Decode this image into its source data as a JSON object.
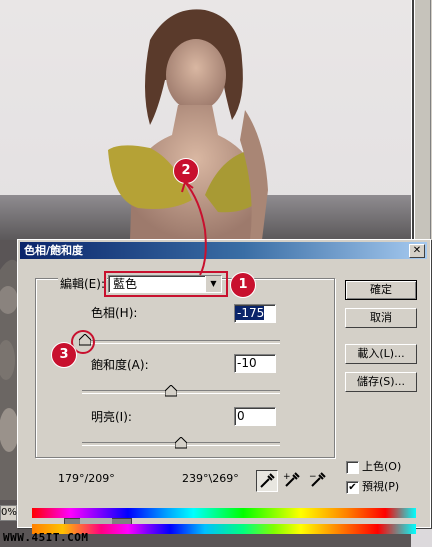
{
  "dialog": {
    "title": "色相/飽和度",
    "close_label": "✕",
    "edit_label": "編輯(E):",
    "edit_value": "藍色",
    "hue_label": "色相(H):",
    "hue_value": "-175",
    "saturation_label": "飽和度(A):",
    "saturation_value": "-10",
    "lightness_label": "明亮(I):",
    "lightness_value": "0",
    "range_left": "179°/209°",
    "range_right": "239°\\269°",
    "buttons": {
      "ok": "確定",
      "cancel": "取消",
      "load": "載入(L)...",
      "save": "儲存(S)..."
    },
    "colorize_label": "上色(O)",
    "colorize_checked": false,
    "preview_label": "預視(P)",
    "preview_checked": true,
    "preview_mark": "✔"
  },
  "sliders": {
    "hue_fraction": 0.014,
    "saturation_fraction": 0.45,
    "lightness_fraction": 0.5
  },
  "annotations": [
    "1",
    "2",
    "3"
  ],
  "zoom_text": "0%",
  "watermark": "WWW.45IT.COM",
  "colors": {
    "accent_red": "#c8102e",
    "title_blue": "#0a246a",
    "dialog_gray": "#d4d0c8"
  },
  "icons": [
    "eyedropper-icon",
    "eyedropper-plus-icon",
    "eyedropper-minus-icon",
    "dropdown-arrow-icon",
    "close-icon",
    "slider-thumb-icon"
  ]
}
